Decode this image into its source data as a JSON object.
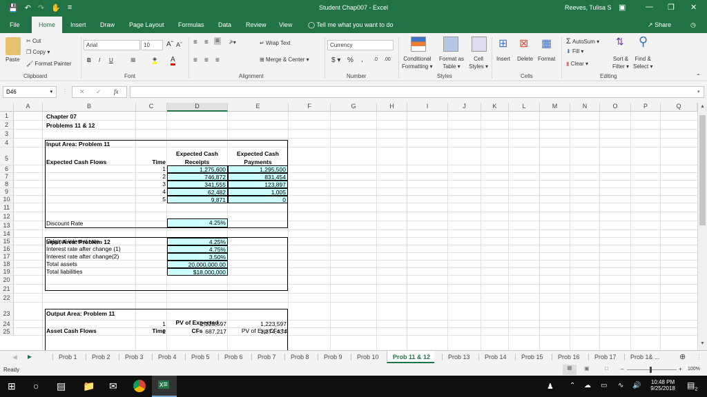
{
  "window": {
    "title": "Student Chap007  -  Excel",
    "user": "Reeves, Tulisa S"
  },
  "menu_tabs": [
    "File",
    "Home",
    "Insert",
    "Draw",
    "Page Layout",
    "Formulas",
    "Data",
    "Review",
    "View"
  ],
  "tell_me": "Tell me what you want to do",
  "share_label": "Share",
  "ribbon": {
    "clipboard": {
      "paste": "Paste",
      "cut": "Cut",
      "copy": "Copy",
      "format_painter": "Format Painter",
      "label": "Clipboard"
    },
    "font": {
      "name": "Arial",
      "size": "10",
      "bold": "B",
      "italic": "I",
      "underline": "U",
      "label": "Font"
    },
    "alignment": {
      "wrap_text": "Wrap Text",
      "merge_center": "Merge & Center",
      "label": "Alignment"
    },
    "number": {
      "format": "Currency",
      "dollar": "$",
      "percent": "%",
      "comma": ",",
      "label": "Number"
    },
    "styles": {
      "conditional": "Conditional",
      "conditional2": "Formatting",
      "format_as": "Format as",
      "format_as2": "Table",
      "cell": "Cell",
      "cell2": "Styles",
      "label": "Styles"
    },
    "cells": {
      "insert": "Insert",
      "delete": "Delete",
      "format": "Format",
      "label": "Cells"
    },
    "editing": {
      "autosum": "AutoSum",
      "fill": "Fill",
      "clear": "Clear",
      "sort": "Sort &",
      "sort2": "Filter",
      "find": "Find &",
      "find2": "Select",
      "label": "Editing"
    }
  },
  "formula_bar": {
    "name_box": "D46",
    "fx": "fx",
    "formula": ""
  },
  "columns": [
    "A",
    "B",
    "C",
    "D",
    "E",
    "F",
    "G",
    "H",
    "I",
    "J",
    "K",
    "L",
    "M",
    "N",
    "O",
    "P",
    "Q"
  ],
  "rows": [
    "1",
    "2",
    "3",
    "4",
    "5",
    "6",
    "7",
    "8",
    "9",
    "10",
    "11",
    "12",
    "13",
    "14",
    "15",
    "16",
    "17",
    "18",
    "19",
    "20",
    "21",
    "22",
    "23",
    "24",
    "25"
  ],
  "sheet": {
    "b1": "Chapter 07",
    "b2": "Problems 11 & 12",
    "b4": "Input Area: Problem 11",
    "b5": "Expected Cash Flows",
    "c5": "Time",
    "d5a": "Expected Cash",
    "d5b": "Receipts",
    "e5a": "Expected Cash",
    "e5b": "Payments",
    "p11_rows": [
      {
        "time": "1",
        "receipts": "1,275,600",
        "payments": "1,295,500"
      },
      {
        "time": "2",
        "receipts": "746,872",
        "payments": "831,454"
      },
      {
        "time": "3",
        "receipts": "341,555",
        "payments": "123,897"
      },
      {
        "time": "4",
        "receipts": "62,482",
        "payments": "1,005"
      },
      {
        "time": "5",
        "receipts": "9,871",
        "payments": "0"
      }
    ],
    "b12": "Discount Rate",
    "d12": "4.25%",
    "b14": "Input Area: Problem 12",
    "p12_rows": [
      {
        "label": "Original interest rate",
        "value": "4.25%"
      },
      {
        "label": "Interest rate after change (1)",
        "value": "4.75%"
      },
      {
        "label": "Interest rate after change(2)",
        "value": "3.50%"
      },
      {
        "label": "Total assets",
        "value": "20,000,000.00"
      },
      {
        "label": "Total liabilities",
        "value": "$18,000,000"
      }
    ],
    "b22": "Output Area: Problem 11",
    "b23": "Asset Cash Flows",
    "c23": "Time",
    "d23a": "PV of Expected",
    "d23b": "CFs",
    "e23": "PV of Exp CFs * t",
    "out_rows": [
      {
        "time": "1",
        "pv": "1,223,597",
        "pvt": "1,223,597"
      },
      {
        "time": "2",
        "pv": "687,217",
        "pvt": "1,374,434"
      }
    ]
  },
  "sheet_tabs": [
    "Prob 1",
    "Prob 2",
    "Prob 3",
    "Prob 4",
    "Prob 5",
    "Prob 6",
    "Prob 7",
    "Prob 8",
    "Prob 9",
    "Prob 10",
    "Prob 11 & 12",
    "Prob 13",
    "Prob 14",
    "Prob 15",
    "Prob 16",
    "Prob 17",
    "Prob 1& ..."
  ],
  "active_sheet": "Prob 11 & 12",
  "status": {
    "mode": "Ready",
    "zoom": "100%"
  },
  "taskbar": {
    "time": "10:48 PM",
    "date": "9/25/2018",
    "notifications": "2"
  }
}
